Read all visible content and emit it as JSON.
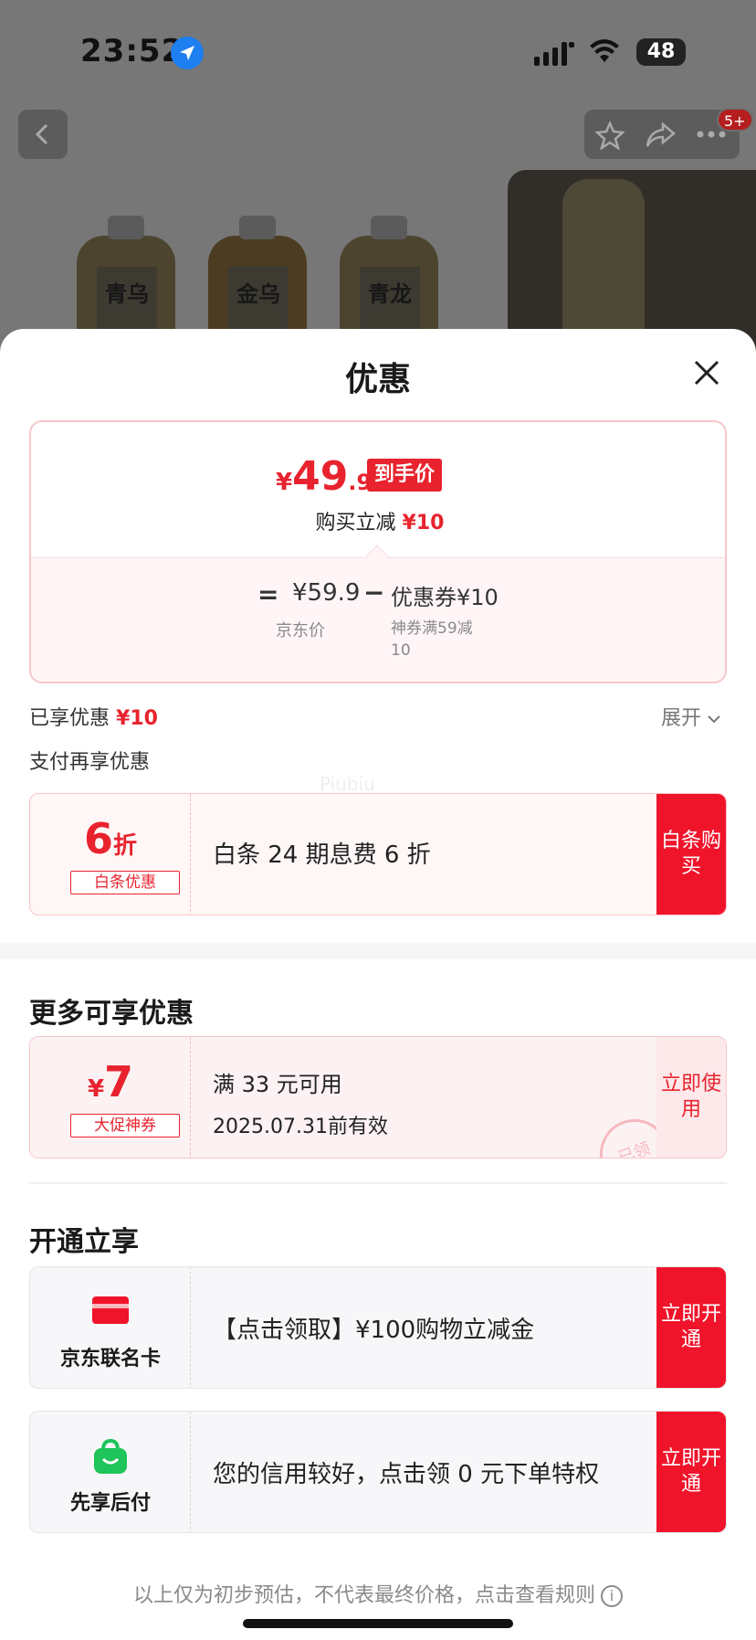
{
  "status_bar": {
    "time": "23:52",
    "battery": "48"
  },
  "nav": {
    "badge": "5+"
  },
  "background": {
    "bottles": [
      {
        "label": "青乌"
      },
      {
        "label": "金乌"
      },
      {
        "label": "青龙"
      }
    ]
  },
  "sheet": {
    "title": "优惠",
    "price": {
      "currency": "¥",
      "integer": "49",
      "decimal": ".9",
      "tag": "到手价",
      "buy_reduce_label": "购买立减",
      "buy_reduce_amount": "¥10",
      "equals": "=",
      "jd_price": "¥59.9",
      "minus": "−",
      "coupon_amount": "优惠券¥10",
      "jd_price_label": "京东价",
      "coupon_desc": "神券满59减10"
    },
    "enjoyed_label": "已享优惠",
    "enjoyed_amount": "¥10",
    "expand_label": "展开",
    "pay_more_label": "支付再享优惠",
    "watermark": "Piubiu",
    "baitiao": {
      "discount_num": "6",
      "discount_unit": "折",
      "tag": "白条优惠",
      "text": "白条 24 期息费 6 折",
      "action": "白条购买"
    },
    "more_section_title": "更多可享优惠",
    "coupon": {
      "currency": "¥",
      "amount": "7",
      "tag": "大促神券",
      "line1": "满 33 元可用",
      "line2": "2025.07.31前有效",
      "stamp": "已领",
      "action": "立即使用"
    },
    "open_section_title": "开通立享",
    "open_items": [
      {
        "label": "京东联名卡",
        "text": "【点击领取】¥100购物立减金",
        "action": "立即开通",
        "icon": "credit-card-icon"
      },
      {
        "label": "先享后付",
        "text": "您的信用较好，点击领 0 元下单特权",
        "action": "立即开通",
        "icon": "shopping-bag-icon"
      }
    ],
    "footer_note": "以上仅为初步预估，不代表最终价格，点击查看规则",
    "colors": {
      "accent": "#e8232e",
      "action_red": "#f0142b",
      "green": "#1fc45a"
    }
  }
}
